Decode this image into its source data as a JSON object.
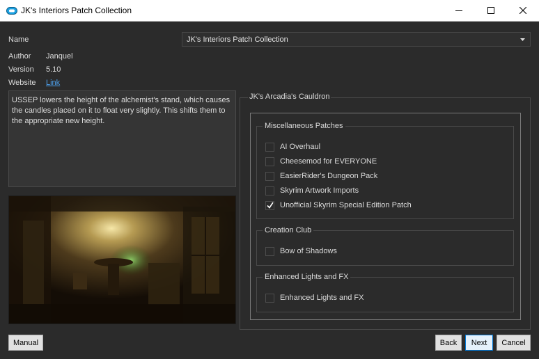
{
  "window": {
    "title": "JK's Interiors Patch Collection"
  },
  "info": {
    "name_label": "Name",
    "name_value": "JK's Interiors Patch Collection",
    "author_label": "Author",
    "author_value": "Janquel",
    "version_label": "Version",
    "version_value": "5.10",
    "website_label": "Website",
    "website_link": "Link"
  },
  "description": "USSEP lowers the height of the alchemist's stand, which causes the candles placed on it to float very slightly. This shifts them to the appropriate new height.",
  "options": {
    "outer_title": "JK's Arcadia's Cauldron",
    "groups": [
      {
        "title": "Miscellaneous Patches",
        "items": [
          {
            "label": "AI Overhaul",
            "checked": false
          },
          {
            "label": "Cheesemod for EVERYONE",
            "checked": false
          },
          {
            "label": "EasierRider's Dungeon Pack",
            "checked": false
          },
          {
            "label": "Skyrim Artwork Imports",
            "checked": false
          },
          {
            "label": "Unofficial Skyrim Special Edition Patch",
            "checked": true
          }
        ]
      },
      {
        "title": "Creation Club",
        "items": [
          {
            "label": "Bow of Shadows",
            "checked": false
          }
        ]
      },
      {
        "title": "Enhanced Lights and FX",
        "items": [
          {
            "label": "Enhanced Lights and FX",
            "checked": false
          }
        ]
      }
    ]
  },
  "buttons": {
    "manual": "Manual",
    "back": "Back",
    "next": "Next",
    "cancel": "Cancel"
  },
  "icons": {
    "app": "installer-icon",
    "minimize": "minimize-icon",
    "maximize": "maximize-icon",
    "close": "close-icon",
    "dropdown": "chevron-down-icon",
    "check": "checkmark-icon"
  },
  "colors": {
    "background": "#2b2b2b",
    "link": "#4ea3f0",
    "accent": "#0078d7"
  }
}
